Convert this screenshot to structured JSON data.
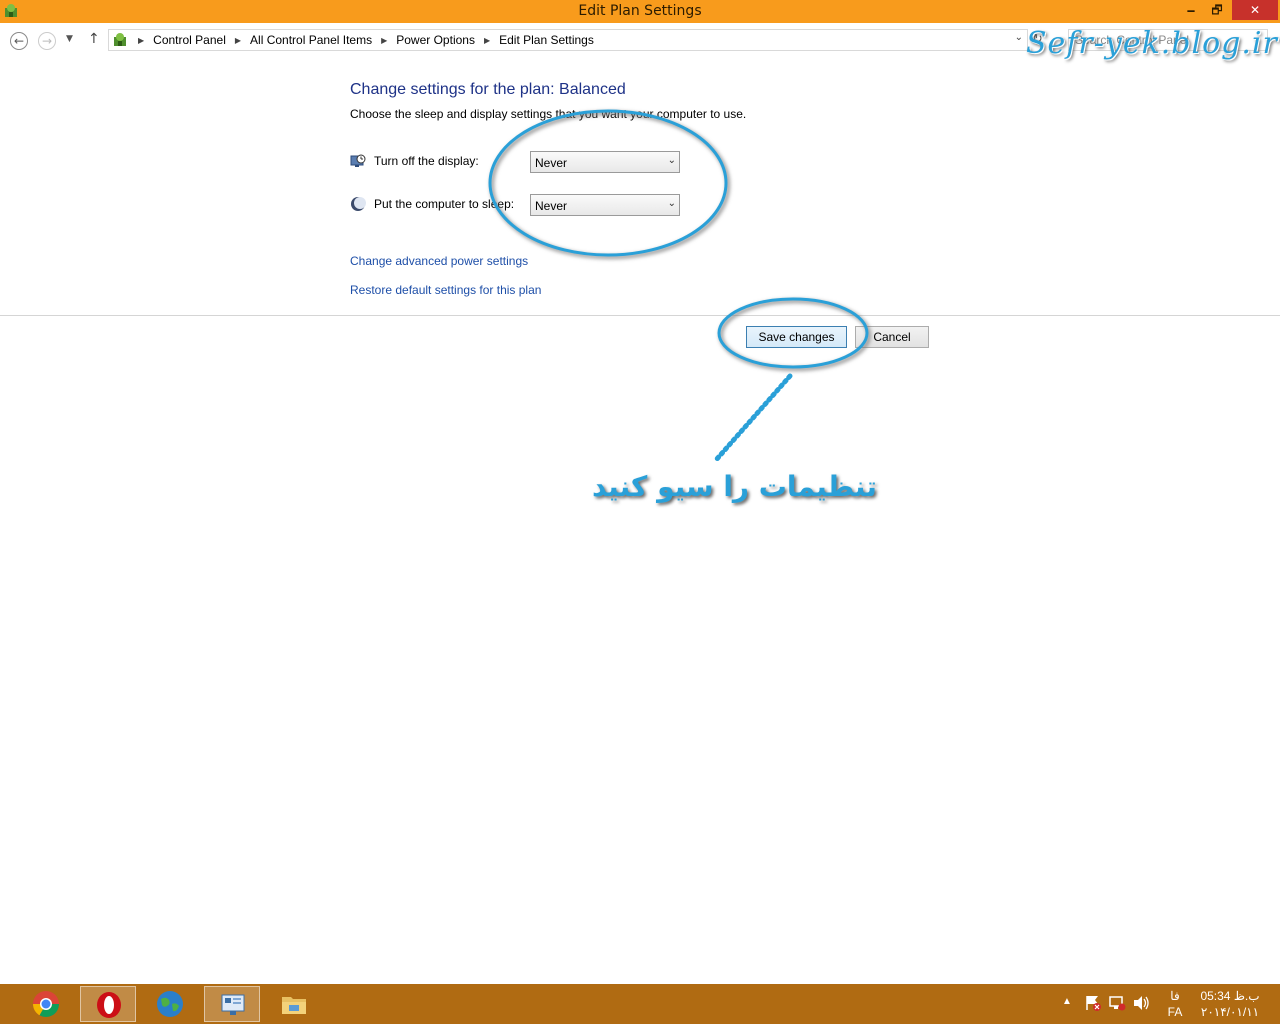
{
  "window": {
    "title": "Edit Plan Settings",
    "minimize_glyph": "🗕",
    "maximize_glyph": "🗗",
    "close_glyph": "✕"
  },
  "navigation": {
    "breadcrumbs": [
      "Control Panel",
      "All Control Panel Items",
      "Power Options",
      "Edit Plan Settings"
    ],
    "search_placeholder": "Search Control Panel"
  },
  "page": {
    "heading": "Change settings for the plan: Balanced",
    "subtitle": "Choose the sleep and display settings that you want your computer to use.",
    "display_label": "Turn off the display:",
    "display_value": "Never",
    "sleep_label": "Put the computer to sleep:",
    "sleep_value": "Never",
    "advanced_link": "Change advanced power settings",
    "restore_link": "Restore default settings for this plan",
    "save_button": "Save changes",
    "cancel_button": "Cancel"
  },
  "overlay": {
    "watermark": "Sefr-yek.blog.ir",
    "annotation": "تنظیمات را سیو کنید",
    "accent_color": "#2aa0d8"
  },
  "taskbar": {
    "apps": [
      "chrome-icon",
      "opera-icon",
      "globe-icon",
      "control-panel-icon",
      "file-explorer-icon"
    ],
    "language_native": "فا",
    "language_code": "FA",
    "time": "05:34 ب.ظ",
    "date": "۲۰۱۴/۰۱/۱۱"
  },
  "colors": {
    "titlebar": "#f89b1c",
    "taskbar": "#b06b12",
    "heading": "#1e3287",
    "link": "#1e4fa8"
  }
}
